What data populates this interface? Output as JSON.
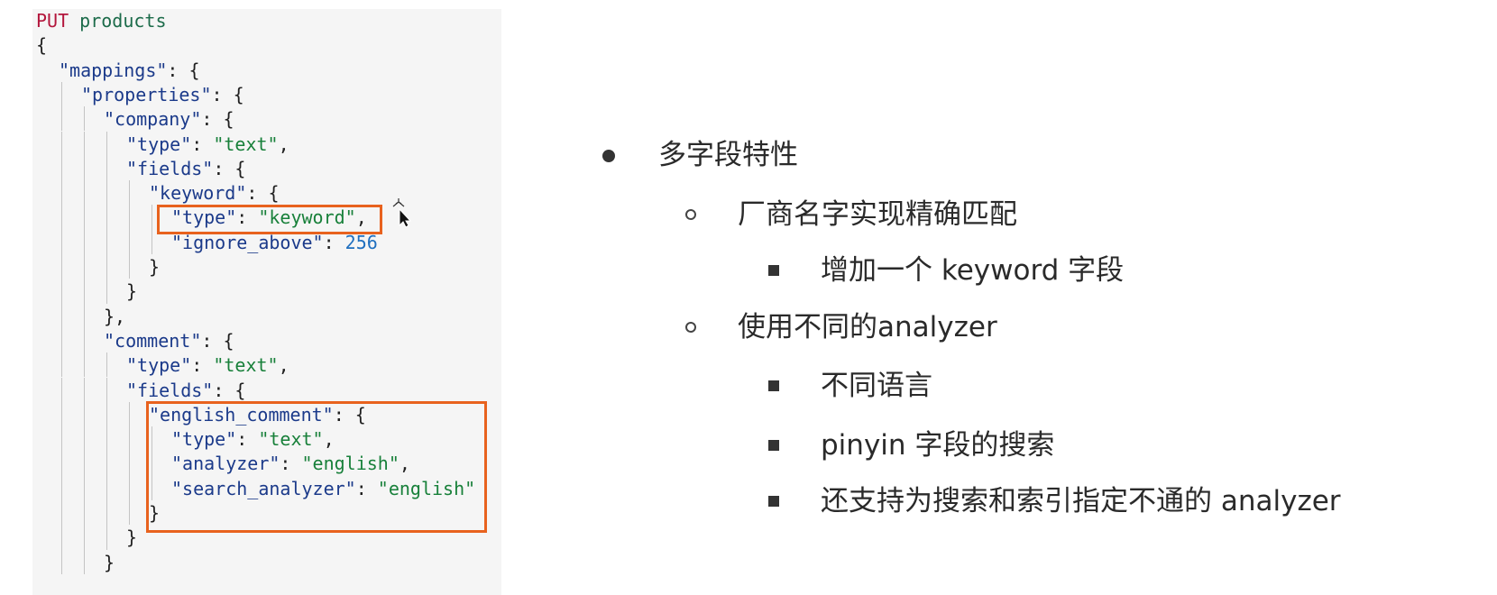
{
  "code": {
    "lines": [
      {
        "indent": 0,
        "tokens": [
          [
            "method",
            "PUT"
          ],
          [
            "p",
            " "
          ],
          [
            "path",
            "products"
          ]
        ]
      },
      {
        "indent": 0,
        "tokens": [
          [
            "p",
            "{"
          ]
        ]
      },
      {
        "indent": 1,
        "tokens": [
          [
            "key",
            "\"mappings\""
          ],
          [
            "p",
            ": {"
          ]
        ]
      },
      {
        "indent": 2,
        "tokens": [
          [
            "key",
            "\"properties\""
          ],
          [
            "p",
            ": {"
          ]
        ]
      },
      {
        "indent": 3,
        "tokens": [
          [
            "key",
            "\"company\""
          ],
          [
            "p",
            ": {"
          ]
        ]
      },
      {
        "indent": 4,
        "tokens": [
          [
            "key",
            "\"type\""
          ],
          [
            "p",
            ": "
          ],
          [
            "str",
            "\"text\""
          ],
          [
            "p",
            ","
          ]
        ]
      },
      {
        "indent": 4,
        "tokens": [
          [
            "key",
            "\"fields\""
          ],
          [
            "p",
            ": {"
          ]
        ]
      },
      {
        "indent": 5,
        "tokens": [
          [
            "key",
            "\"keyword\""
          ],
          [
            "p",
            ": {"
          ]
        ]
      },
      {
        "indent": 6,
        "tokens": [
          [
            "key",
            "\"type\""
          ],
          [
            "p",
            ": "
          ],
          [
            "str",
            "\"keyword\""
          ],
          [
            "p",
            ","
          ]
        ]
      },
      {
        "indent": 6,
        "tokens": [
          [
            "key",
            "\"ignore_above\""
          ],
          [
            "p",
            ": "
          ],
          [
            "num",
            "256"
          ]
        ]
      },
      {
        "indent": 5,
        "tokens": [
          [
            "p",
            "}"
          ]
        ]
      },
      {
        "indent": 4,
        "tokens": [
          [
            "p",
            "}"
          ]
        ]
      },
      {
        "indent": 3,
        "tokens": [
          [
            "p",
            "},"
          ]
        ]
      },
      {
        "indent": 3,
        "tokens": [
          [
            "key",
            "\"comment\""
          ],
          [
            "p",
            ": {"
          ]
        ]
      },
      {
        "indent": 4,
        "tokens": [
          [
            "key",
            "\"type\""
          ],
          [
            "p",
            ": "
          ],
          [
            "str",
            "\"text\""
          ],
          [
            "p",
            ","
          ]
        ]
      },
      {
        "indent": 4,
        "tokens": [
          [
            "key",
            "\"fields\""
          ],
          [
            "p",
            ": {"
          ]
        ]
      },
      {
        "indent": 5,
        "tokens": [
          [
            "key",
            "\"english_comment\""
          ],
          [
            "p",
            ": {"
          ]
        ]
      },
      {
        "indent": 6,
        "tokens": [
          [
            "key",
            "\"type\""
          ],
          [
            "p",
            ": "
          ],
          [
            "str",
            "\"text\""
          ],
          [
            "p",
            ","
          ]
        ]
      },
      {
        "indent": 6,
        "tokens": [
          [
            "key",
            "\"analyzer\""
          ],
          [
            "p",
            ": "
          ],
          [
            "str",
            "\"english\""
          ],
          [
            "p",
            ","
          ]
        ]
      },
      {
        "indent": 6,
        "tokens": [
          [
            "key",
            "\"search_analyzer\""
          ],
          [
            "p",
            ": "
          ],
          [
            "str",
            "\"english\""
          ]
        ]
      },
      {
        "indent": 5,
        "tokens": [
          [
            "p",
            "}"
          ]
        ]
      },
      {
        "indent": 4,
        "tokens": [
          [
            "p",
            "}"
          ]
        ]
      },
      {
        "indent": 3,
        "tokens": [
          [
            "p",
            "}"
          ]
        ]
      }
    ]
  },
  "bullets": [
    {
      "level": 1,
      "text": "多字段特性"
    },
    {
      "level": 2,
      "text": "厂商名字实现精确匹配"
    },
    {
      "level": 3,
      "text": "增加一个 keyword 字段"
    },
    {
      "level": 2,
      "text": "使用不同的analyzer"
    },
    {
      "level": 3,
      "text": "不同语言"
    },
    {
      "level": 3,
      "text": "pinyin 字段的搜索"
    },
    {
      "level": 3,
      "text": "还支持为搜索和索引指定不通的 analyzer"
    }
  ],
  "colors": {
    "highlight": "#e8621e",
    "method": "#b3163c",
    "key": "#1b3a8a",
    "string": "#18803a",
    "number": "#1f6fbf"
  }
}
